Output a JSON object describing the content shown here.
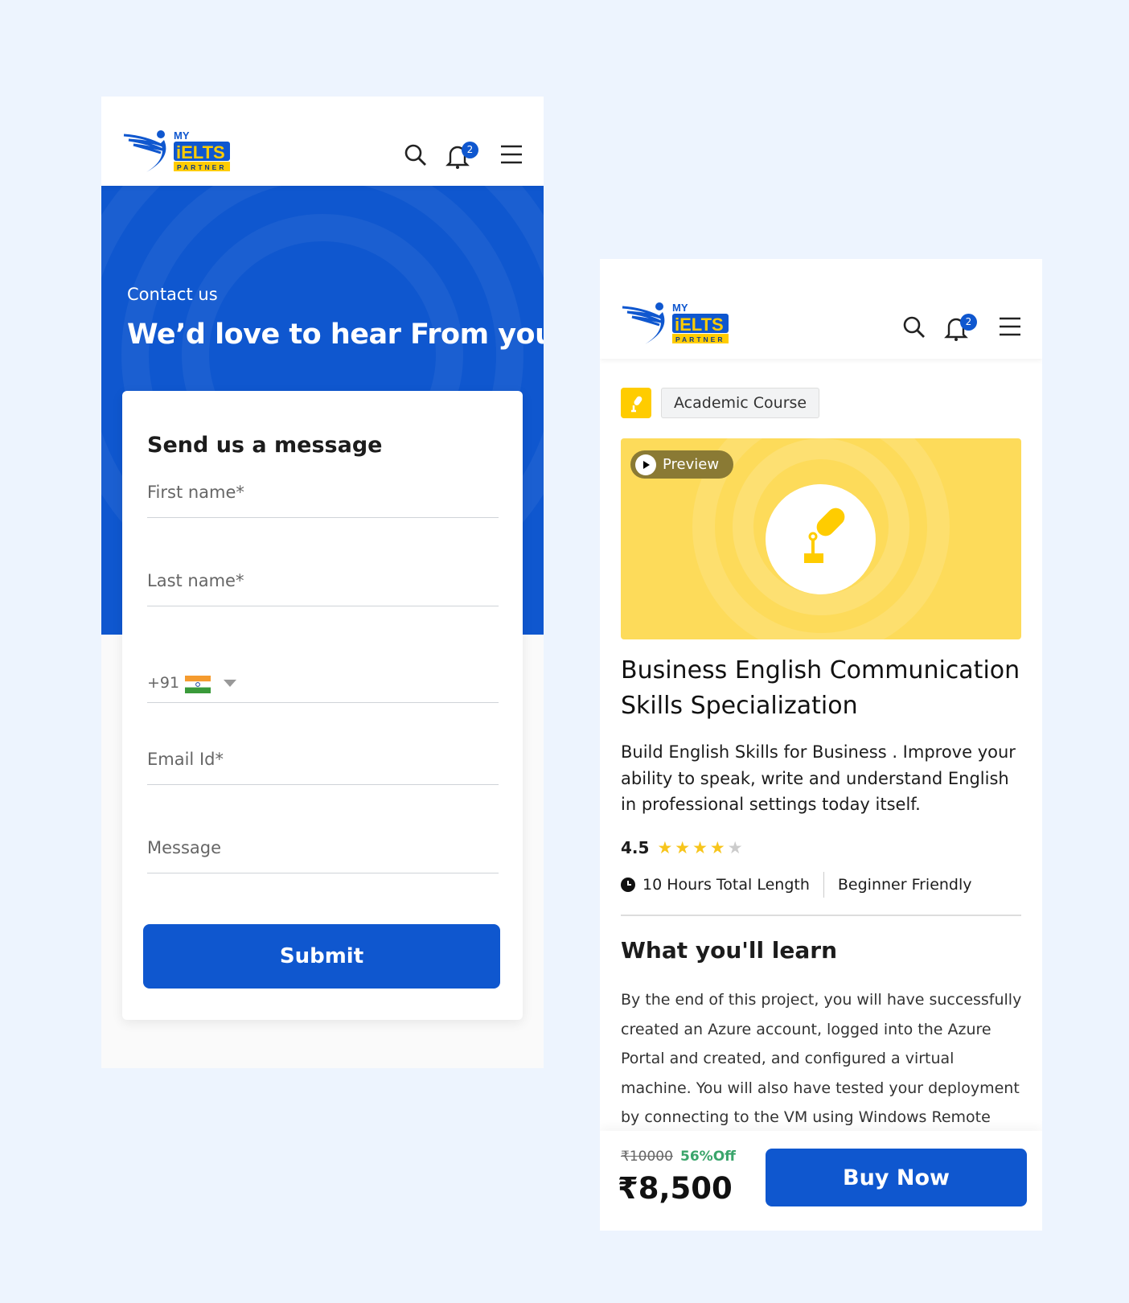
{
  "logo": {
    "my": "MY",
    "ielts": "iELTS",
    "partner": "PARTNER"
  },
  "header": {
    "notification_count": "2"
  },
  "contact": {
    "eyebrow": "Contact us",
    "title": "We’d love to hear From you!",
    "form_title": "Send us a message",
    "first_name": "First name*",
    "last_name": "Last name*",
    "phone_code": "+91",
    "email": "Email Id*",
    "message": "Message",
    "submit": "Submit"
  },
  "course": {
    "tag": "Academic Course",
    "preview": "Preview",
    "title_line1": "Business English Communication",
    "title_line2": "Skills Specialization",
    "description": "Build English Skills for Business . Improve your ability to speak, write and understand English in professional settings today itself.",
    "rating": "4.5",
    "rating_value": 4.5,
    "rating_max": 5,
    "length": "10 Hours Total Length",
    "level": "Beginner Friendly",
    "learn_title": "What you'll learn",
    "learn_text": "By the end of this project, you will have successfully created an Azure account, logged into the Azure Portal and created, and configured a virtual machine. You will also have tested your deployment by connecting to the VM using Windows Remote",
    "old_price": "₹10000",
    "discount": "56%Off",
    "price": "₹8,500",
    "buy": "Buy Now"
  },
  "colors": {
    "primary": "#0f57cf",
    "accent": "#ffcc00",
    "discount": "#3aa56b",
    "star": "#f7c51c"
  }
}
